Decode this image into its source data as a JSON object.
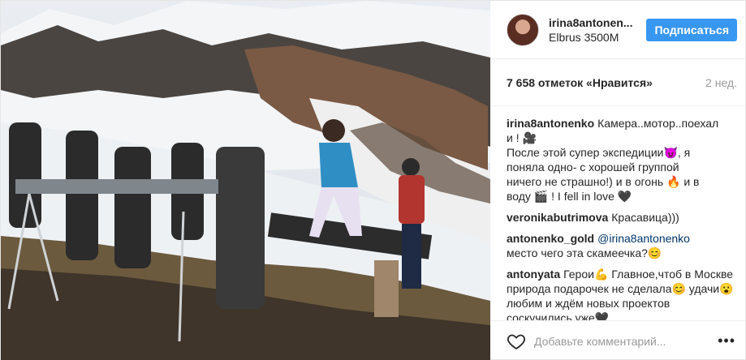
{
  "post": {
    "username": "irina8antonen...",
    "location": "Elbrus 3500M",
    "follow_label": "Подписаться",
    "likes": "7 658 отметок «Нравится»",
    "time": "2 нед."
  },
  "caption": {
    "username": "irina8antonenko",
    "lines": [
      "Камера..мотор..поехал",
      "и ! 🎥",
      "После этой супер экспедиции😈, я",
      "поняла одно- с хорошей группой",
      "ничего не страшно!) и в огонь 🔥 и в",
      "воду 🎬 ! I fell in love 🖤"
    ]
  },
  "comments": [
    {
      "username": "veronikabutrimova",
      "text": "Красавица)))"
    },
    {
      "username": "antonenko_gold",
      "mention": "@irina8antonenko",
      "text": "место чего эта скамеечка?😊"
    },
    {
      "username": "antonyata",
      "text": "Герои💪 Главное,чтоб в Москве природа подарочек не сделала😊 удачи😮 любим и ждём новых проектов соскучились уже🖤"
    }
  ],
  "add_comment": {
    "placeholder": "Добавьте комментарий...",
    "more": "•••"
  },
  "icons": {
    "heart": "heart-outline-icon",
    "more": "more-options-icon"
  },
  "colors": {
    "accent": "#3897f0",
    "border": "#efefef",
    "muted": "#999999"
  }
}
